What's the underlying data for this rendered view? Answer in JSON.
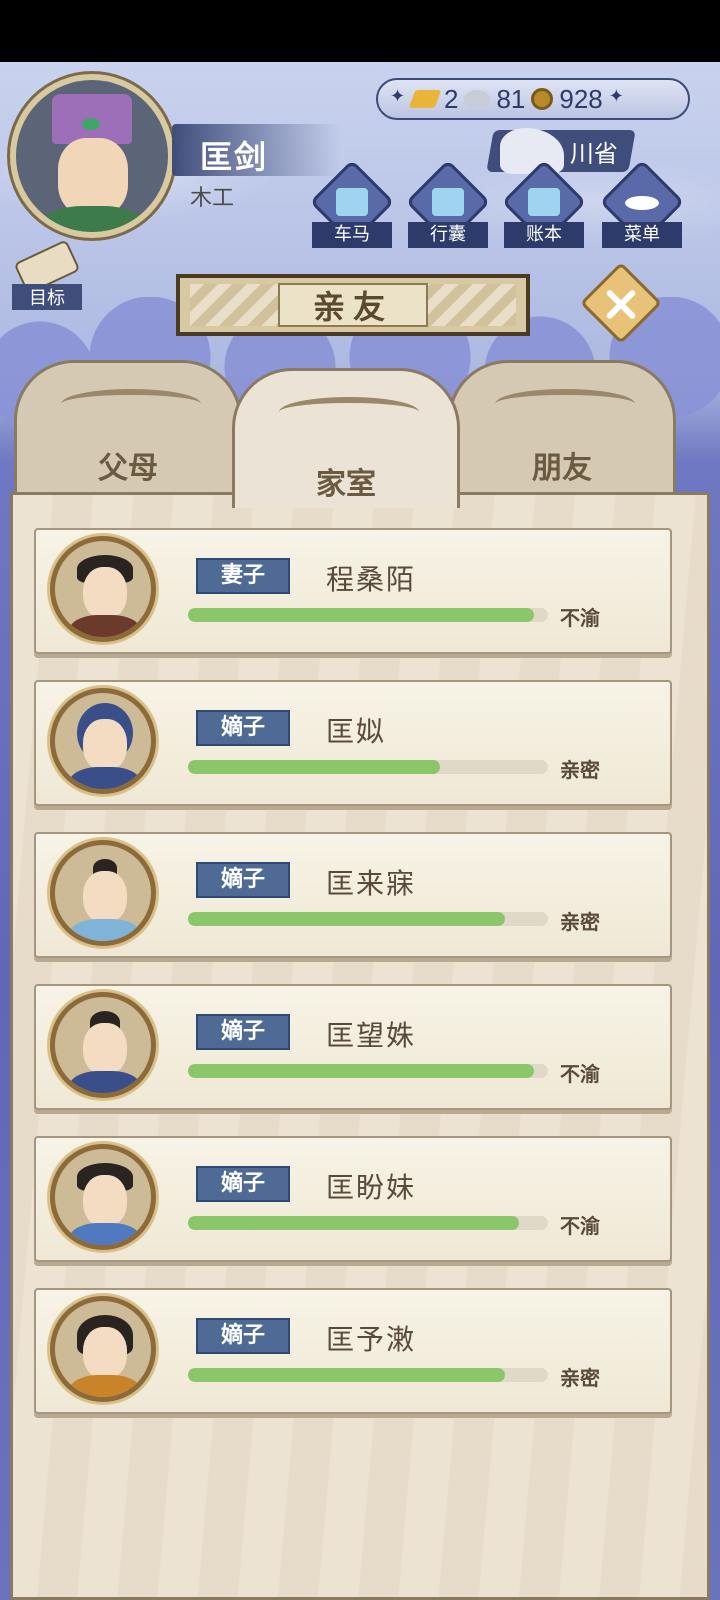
{
  "player": {
    "name": "匡剑",
    "occupation": "木工"
  },
  "currency": {
    "gold": "2",
    "silver": "81",
    "copper": "928"
  },
  "location": "川省",
  "menu": [
    {
      "label": "车马",
      "icon": "carriage-icon"
    },
    {
      "label": "行囊",
      "icon": "bag-icon"
    },
    {
      "label": "账本",
      "icon": "ledger-icon"
    },
    {
      "label": "菜单",
      "icon": "more-icon"
    }
  ],
  "goal_label": "目标",
  "title": "亲友",
  "tabs": [
    {
      "label": "父母",
      "active": false
    },
    {
      "label": "家室",
      "active": true
    },
    {
      "label": "朋友",
      "active": false
    }
  ],
  "members": [
    {
      "relation": "妻子",
      "name": "程桑陌",
      "affinity": 0.96,
      "status": "不渝"
    },
    {
      "relation": "嫡子",
      "name": "匡姒",
      "affinity": 0.7,
      "status": "亲密"
    },
    {
      "relation": "嫡子",
      "name": "匡来寐",
      "affinity": 0.88,
      "status": "亲密"
    },
    {
      "relation": "嫡子",
      "name": "匡望姝",
      "affinity": 0.96,
      "status": "不渝"
    },
    {
      "relation": "嫡子",
      "name": "匡盼妹",
      "affinity": 0.92,
      "status": "不渝"
    },
    {
      "relation": "嫡子",
      "name": "匡予潄",
      "affinity": 0.88,
      "status": "亲密"
    }
  ],
  "colors": {
    "bar_fill": "#8cc66a",
    "relation_badge": "#4f6a94",
    "panel": "#ece3d3"
  }
}
